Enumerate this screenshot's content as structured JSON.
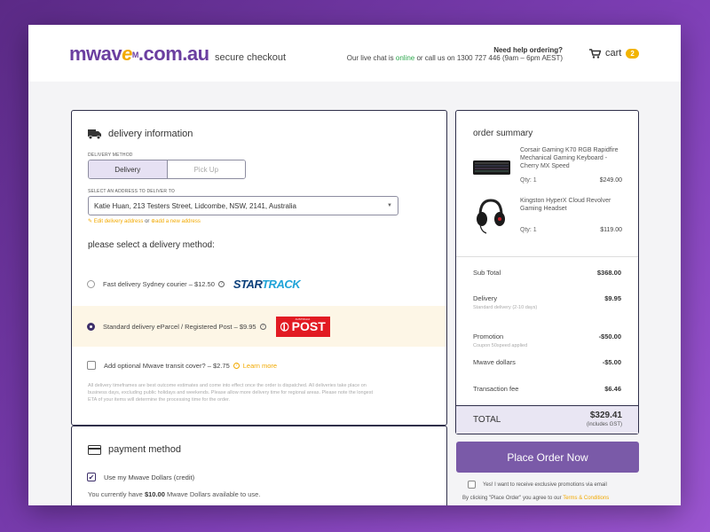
{
  "header": {
    "logo_main": "mwave",
    "logo_suffix": ".com.au",
    "secure_checkout": "secure checkout",
    "help_title": "Need help ordering?",
    "help_pre": "Our live chat is ",
    "help_online": "online",
    "help_post": " or call us on 1300 727 446 (9am – 6pm AEST)",
    "cart_label": "cart",
    "cart_count": "2"
  },
  "delivery": {
    "section_title": "delivery information",
    "method_label": "DELIVERY METHOD",
    "method_options": [
      "Delivery",
      "Pick Up"
    ],
    "address_label": "SELECT AN ADDRESS TO DELIVER TO",
    "address_value": "Katie Huan, 213 Testers Street, Lidcombe, NSW, 2141, Australia",
    "edit_link": "Edit delivery address",
    "or_text": "or",
    "add_link": "add a new address",
    "select_prompt": "please select a delivery method:",
    "options": [
      {
        "label": "Fast delivery Sydney courier – $12.50",
        "carrier": "STARTRACK"
      },
      {
        "label": "Standard delivery eParcel / Registered Post – $9.95",
        "carrier": "AUSTRALIA POST"
      }
    ],
    "transit_cover": "Add optional Mwave transit cover? – $2.75",
    "learn_more": "Learn more",
    "disclaimer": "All delivery timeframes are best outcome estimates and come into effect once the order is dispatched. All deliveries take place on business days, excluding public holidays and weekends. Please allow more delivery time for regional areas. Please note the longest ETA of your items will determine the processing time for the order."
  },
  "payment": {
    "section_title": "payment method",
    "use_dollars": "Use my Mwave Dollars (credit)",
    "note_pre": "You currently have ",
    "note_amount": "$10.00",
    "note_post": " Mwave Dollars available to use."
  },
  "summary": {
    "title": "order summary",
    "items": [
      {
        "name": "Corsair Gaming K70 RGB Rapidfire Mechanical Gaming Keyboard - Cherry MX Speed",
        "qty": "Qty: 1",
        "price": "$249.00"
      },
      {
        "name": "Kingston HyperX Cloud Revolver Gaming Headset",
        "qty": "Qty: 1",
        "price": "$119.00"
      }
    ],
    "subtotal_label": "Sub Total",
    "subtotal": "$368.00",
    "delivery_label": "Delivery",
    "delivery_sub": "Standard delivery (2-10 days)",
    "delivery": "$9.95",
    "promotion_label": "Promotion",
    "promotion_sub": "Coupon 50speed applied",
    "promotion": "-$50.00",
    "dollars_label": "Mwave dollars",
    "dollars": "-$5.00",
    "fee_label": "Transaction fee",
    "fee": "$6.46",
    "total_label": "TOTAL",
    "total": "$329.41",
    "gst": "(includes GST)"
  },
  "actions": {
    "place_order": "Place Order Now",
    "promo_optin": "Yes! I want to receive exclusive promotions via email",
    "terms_pre": "By clicking \"Place Order\" you agree to our ",
    "terms_link": "Terms & Conditions"
  },
  "colors": {
    "brand_purple": "#6b3fa0",
    "accent_yellow": "#f2a900",
    "button_purple": "#7a5aa8"
  }
}
